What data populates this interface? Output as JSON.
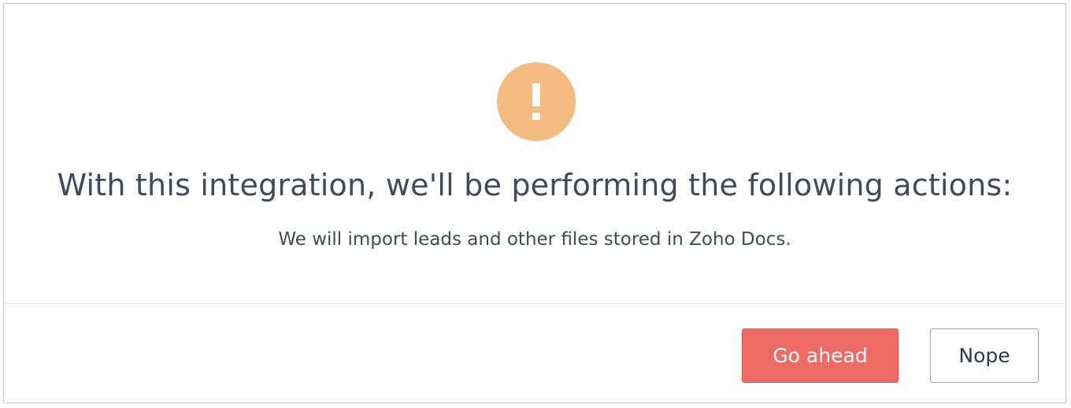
{
  "dialog": {
    "icon": "exclamation-alert-icon",
    "icon_color": "#f3bb7f",
    "heading": "With this integration, we'll be performing the following actions:",
    "description": "We will import leads and other files stored in Zoho Docs."
  },
  "actions": {
    "confirm_label": "Go ahead",
    "cancel_label": "Nope",
    "confirm_color": "#ee6a64"
  }
}
